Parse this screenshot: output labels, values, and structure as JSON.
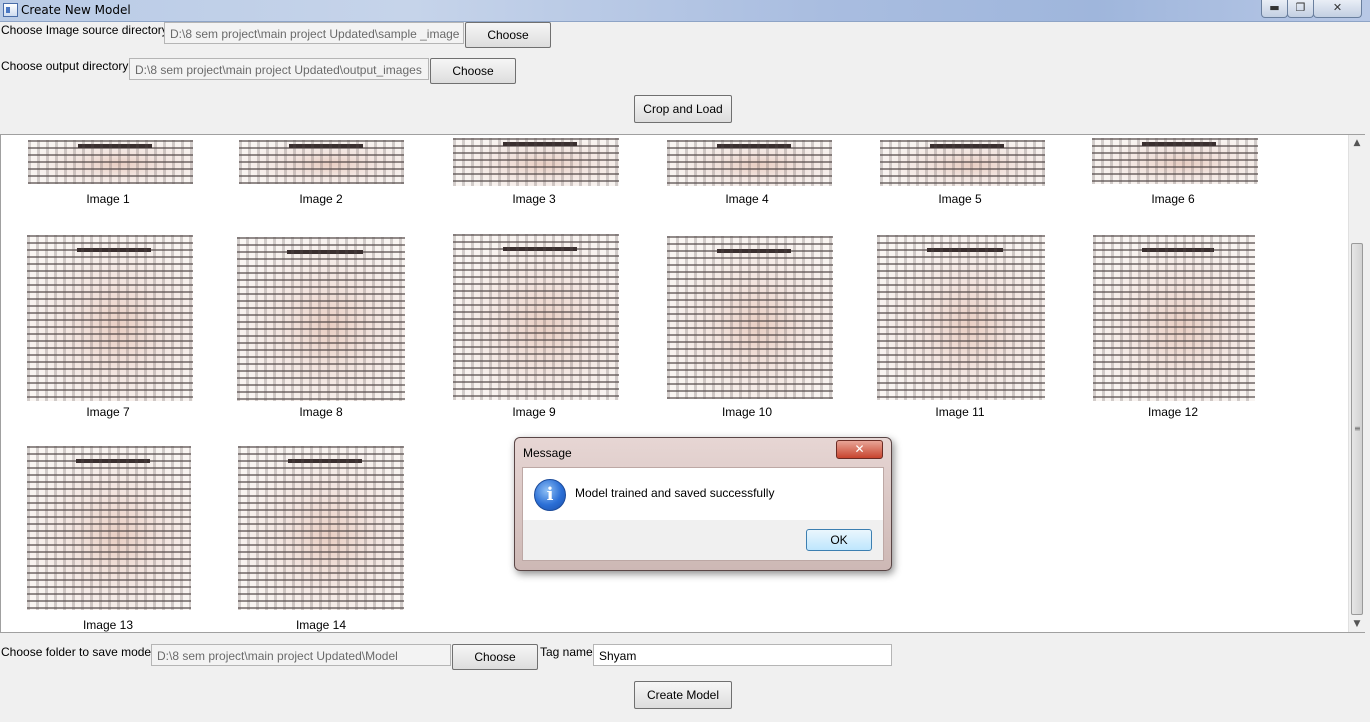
{
  "window": {
    "title": "Create New Model",
    "controls": {
      "minimize": "▬",
      "restore": "❐",
      "close": "✕"
    }
  },
  "source": {
    "label": "Choose Image source directory",
    "value": "D:\\8 sem project\\main project Updated\\sample _image",
    "button": "Choose"
  },
  "output": {
    "label": "Choose output directory",
    "value": "D:\\8 sem project\\main project Updated\\output_images",
    "button": "Choose"
  },
  "crop_button": "Crop and Load",
  "gallery": {
    "images": [
      "Image 1",
      "Image 2",
      "Image 3",
      "Image 4",
      "Image 5",
      "Image 6",
      "Image 7",
      "Image 8",
      "Image 9",
      "Image 10",
      "Image 11",
      "Image 12",
      "Image 13",
      "Image 14"
    ]
  },
  "model_folder": {
    "label": "Choose folder to save model",
    "value": "D:\\8 sem project\\main project Updated\\Model",
    "button": "Choose"
  },
  "tag": {
    "label": "Tag name",
    "value": "Shyam"
  },
  "create_button": "Create Model",
  "dialog": {
    "title": "Message",
    "close": "✕",
    "icon": "info-icon",
    "icon_glyph": "i",
    "message": "Model trained and saved successfully",
    "ok": "OK"
  },
  "scrollbar": {
    "up": "▲",
    "down": "▼",
    "grip": "≡"
  },
  "colors": {
    "ok_border": "#3c7fb1",
    "dialog_close": "#c7442e",
    "info_icon": "#2b6fd6"
  }
}
